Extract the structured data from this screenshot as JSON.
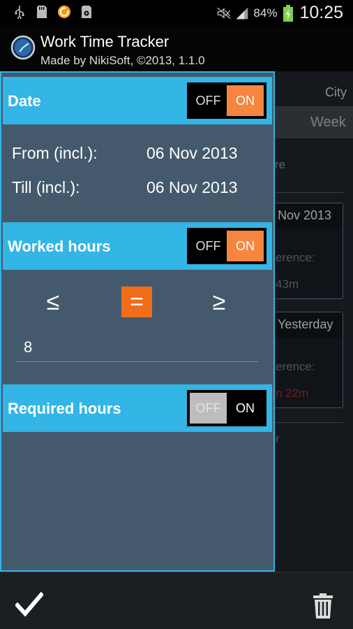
{
  "status_bar": {
    "icons_left": [
      "usb-icon",
      "sd-card-icon",
      "sync-app-icon",
      "sd-card-settings-icon"
    ],
    "icons_right": [
      "mute-icon",
      "signal-icon"
    ],
    "battery": "84%",
    "time": "10:25"
  },
  "app": {
    "title": "Work Time Tracker",
    "subtitle": "Made by NikiSoft, ©2013, 1.1.0"
  },
  "background": {
    "city_label": "City",
    "week_label": "Week",
    "re_text": "re",
    "card1_head": "Nov 2013",
    "card1_line1": "erence:",
    "card1_line2": "43m",
    "card2_head": "Yesterday",
    "card2_line1": "erence:",
    "card2_line2": "n 22m",
    "bottom_text": "r"
  },
  "filter": {
    "date": {
      "title": "Date",
      "toggle_off": "OFF",
      "toggle_on": "ON",
      "state": "on",
      "from_label": "From (incl.):",
      "from_value": "06 Nov 2013",
      "till_label": "Till (incl.):",
      "till_value": "06 Nov 2013"
    },
    "worked_hours": {
      "title": "Worked hours",
      "toggle_off": "OFF",
      "toggle_on": "ON",
      "state": "on",
      "op_le": "≤",
      "op_eq": "=",
      "op_ge": "≥",
      "selected_op": "=",
      "value": "8"
    },
    "required_hours": {
      "title": "Required hours",
      "toggle_off": "OFF",
      "toggle_on": "ON",
      "state": "off"
    }
  },
  "bottom_bar": {
    "accept_icon": "checkmark-icon",
    "delete_icon": "trash-icon"
  },
  "colors": {
    "accent_blue": "#33b5e5",
    "toggle_orange": "#f5853f",
    "selected_op_orange": "#f26c19",
    "panel_bg": "#445a6c"
  }
}
